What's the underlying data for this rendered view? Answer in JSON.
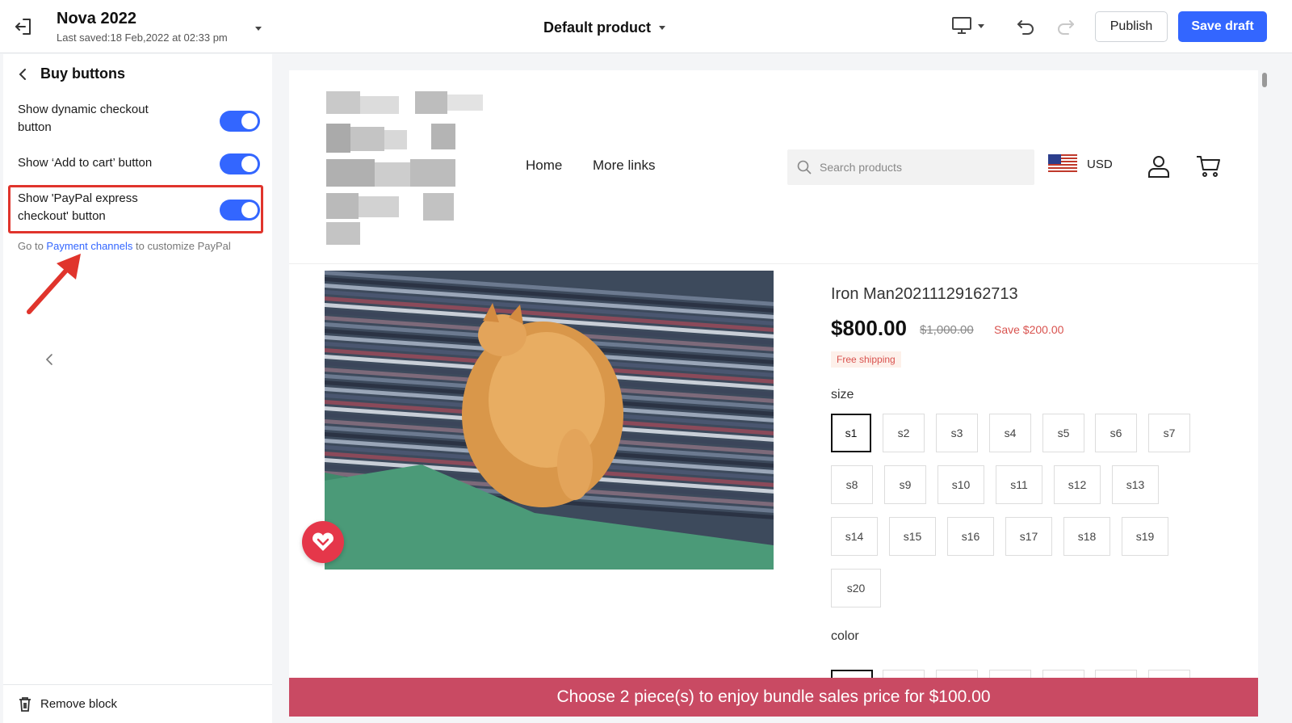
{
  "topbar": {
    "store_name": "Nova 2022",
    "last_saved": "Last saved:18 Feb,2022 at 02:33 pm",
    "page_select": "Default product",
    "publish_label": "Publish",
    "save_draft_label": "Save draft",
    "accent_color": "#3366ff"
  },
  "sidebar": {
    "title": "Buy buttons",
    "settings": [
      {
        "label": "Show dynamic checkout button",
        "enabled": true
      },
      {
        "label": "Show ‘Add to cart’ button",
        "enabled": true
      },
      {
        "label": "Show 'PayPal express checkout' button",
        "enabled": true
      }
    ],
    "helper_prefix": "Go to",
    "helper_link": "Payment channels",
    "helper_suffix": "to customize PayPal",
    "remove_block_label": "Remove block",
    "highlight_color": "#e0342c"
  },
  "store": {
    "nav": [
      "Home",
      "More links"
    ],
    "search_placeholder": "Search products",
    "currency": "USD"
  },
  "product": {
    "title": "Iron Man20211129162713",
    "price": "$800.00",
    "compare_price": "$1,000.00",
    "save_text": "Save $200.00",
    "shipping_badge": "Free shipping",
    "size_label": "size",
    "sizes": [
      "s1",
      "s2",
      "s3",
      "s4",
      "s5",
      "s6",
      "s7",
      "s8",
      "s9",
      "s10",
      "s11",
      "s12",
      "s13",
      "s14",
      "s15",
      "s16",
      "s17",
      "s18",
      "s19",
      "s20"
    ],
    "selected_size": "s1",
    "color_label": "color"
  },
  "bundle_bar": {
    "text": "Choose 2 piece(s) to enjoy bundle sales price for $100.00",
    "color": "#c94a63"
  }
}
